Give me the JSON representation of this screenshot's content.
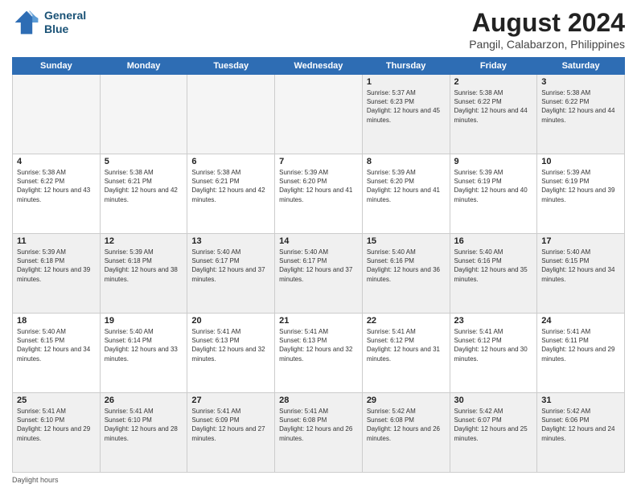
{
  "header": {
    "logo_line1": "General",
    "logo_line2": "Blue",
    "title": "August 2024",
    "subtitle": "Pangil, Calabarzon, Philippines"
  },
  "days_of_week": [
    "Sunday",
    "Monday",
    "Tuesday",
    "Wednesday",
    "Thursday",
    "Friday",
    "Saturday"
  ],
  "footer": {
    "note": "Daylight hours"
  },
  "weeks": [
    [
      {
        "day": "",
        "empty": true
      },
      {
        "day": "",
        "empty": true
      },
      {
        "day": "",
        "empty": true
      },
      {
        "day": "",
        "empty": true
      },
      {
        "day": "1",
        "sunrise": "5:37 AM",
        "sunset": "6:23 PM",
        "daylight": "12 hours and 45 minutes."
      },
      {
        "day": "2",
        "sunrise": "5:38 AM",
        "sunset": "6:22 PM",
        "daylight": "12 hours and 44 minutes."
      },
      {
        "day": "3",
        "sunrise": "5:38 AM",
        "sunset": "6:22 PM",
        "daylight": "12 hours and 44 minutes."
      }
    ],
    [
      {
        "day": "4",
        "sunrise": "5:38 AM",
        "sunset": "6:22 PM",
        "daylight": "12 hours and 43 minutes."
      },
      {
        "day": "5",
        "sunrise": "5:38 AM",
        "sunset": "6:21 PM",
        "daylight": "12 hours and 42 minutes."
      },
      {
        "day": "6",
        "sunrise": "5:38 AM",
        "sunset": "6:21 PM",
        "daylight": "12 hours and 42 minutes."
      },
      {
        "day": "7",
        "sunrise": "5:39 AM",
        "sunset": "6:20 PM",
        "daylight": "12 hours and 41 minutes."
      },
      {
        "day": "8",
        "sunrise": "5:39 AM",
        "sunset": "6:20 PM",
        "daylight": "12 hours and 41 minutes."
      },
      {
        "day": "9",
        "sunrise": "5:39 AM",
        "sunset": "6:19 PM",
        "daylight": "12 hours and 40 minutes."
      },
      {
        "day": "10",
        "sunrise": "5:39 AM",
        "sunset": "6:19 PM",
        "daylight": "12 hours and 39 minutes."
      }
    ],
    [
      {
        "day": "11",
        "sunrise": "5:39 AM",
        "sunset": "6:18 PM",
        "daylight": "12 hours and 39 minutes."
      },
      {
        "day": "12",
        "sunrise": "5:39 AM",
        "sunset": "6:18 PM",
        "daylight": "12 hours and 38 minutes."
      },
      {
        "day": "13",
        "sunrise": "5:40 AM",
        "sunset": "6:17 PM",
        "daylight": "12 hours and 37 minutes."
      },
      {
        "day": "14",
        "sunrise": "5:40 AM",
        "sunset": "6:17 PM",
        "daylight": "12 hours and 37 minutes."
      },
      {
        "day": "15",
        "sunrise": "5:40 AM",
        "sunset": "6:16 PM",
        "daylight": "12 hours and 36 minutes."
      },
      {
        "day": "16",
        "sunrise": "5:40 AM",
        "sunset": "6:16 PM",
        "daylight": "12 hours and 35 minutes."
      },
      {
        "day": "17",
        "sunrise": "5:40 AM",
        "sunset": "6:15 PM",
        "daylight": "12 hours and 34 minutes."
      }
    ],
    [
      {
        "day": "18",
        "sunrise": "5:40 AM",
        "sunset": "6:15 PM",
        "daylight": "12 hours and 34 minutes."
      },
      {
        "day": "19",
        "sunrise": "5:40 AM",
        "sunset": "6:14 PM",
        "daylight": "12 hours and 33 minutes."
      },
      {
        "day": "20",
        "sunrise": "5:41 AM",
        "sunset": "6:13 PM",
        "daylight": "12 hours and 32 minutes."
      },
      {
        "day": "21",
        "sunrise": "5:41 AM",
        "sunset": "6:13 PM",
        "daylight": "12 hours and 32 minutes."
      },
      {
        "day": "22",
        "sunrise": "5:41 AM",
        "sunset": "6:12 PM",
        "daylight": "12 hours and 31 minutes."
      },
      {
        "day": "23",
        "sunrise": "5:41 AM",
        "sunset": "6:12 PM",
        "daylight": "12 hours and 30 minutes."
      },
      {
        "day": "24",
        "sunrise": "5:41 AM",
        "sunset": "6:11 PM",
        "daylight": "12 hours and 29 minutes."
      }
    ],
    [
      {
        "day": "25",
        "sunrise": "5:41 AM",
        "sunset": "6:10 PM",
        "daylight": "12 hours and 29 minutes."
      },
      {
        "day": "26",
        "sunrise": "5:41 AM",
        "sunset": "6:10 PM",
        "daylight": "12 hours and 28 minutes."
      },
      {
        "day": "27",
        "sunrise": "5:41 AM",
        "sunset": "6:09 PM",
        "daylight": "12 hours and 27 minutes."
      },
      {
        "day": "28",
        "sunrise": "5:41 AM",
        "sunset": "6:08 PM",
        "daylight": "12 hours and 26 minutes."
      },
      {
        "day": "29",
        "sunrise": "5:42 AM",
        "sunset": "6:08 PM",
        "daylight": "12 hours and 26 minutes."
      },
      {
        "day": "30",
        "sunrise": "5:42 AM",
        "sunset": "6:07 PM",
        "daylight": "12 hours and 25 minutes."
      },
      {
        "day": "31",
        "sunrise": "5:42 AM",
        "sunset": "6:06 PM",
        "daylight": "12 hours and 24 minutes."
      }
    ]
  ]
}
